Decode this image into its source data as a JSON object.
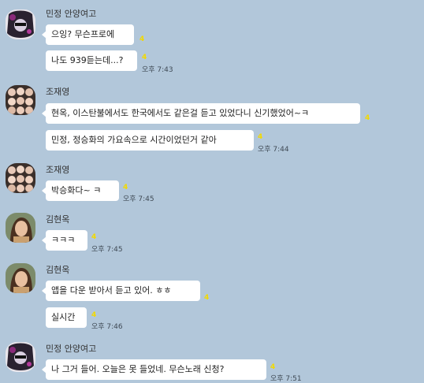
{
  "colors": {
    "background": "#b2c7da",
    "bubble": "#ffffff",
    "unread": "#f2d900"
  },
  "messages": [
    {
      "sender": "민정 안양여고",
      "avatar": "avatar-dark-icon",
      "bubbles": [
        {
          "text": "으잉? 무슨프로에",
          "unread": "4",
          "time": ""
        },
        {
          "text": "나도 939듣는데...?",
          "unread": "4",
          "time": "오후 7:43"
        }
      ]
    },
    {
      "sender": "조재영",
      "avatar": "avatar-group-icon",
      "bubbles": [
        {
          "text": "현옥, 이스탄불에서도 한국에서도 같은걸 듣고 있었다니 신기했었어~ㅋ",
          "unread": "4",
          "time": ""
        },
        {
          "text": "민정, 정승화의 가요속으로 시간이었던거 같아",
          "unread": "4",
          "time": "오후 7:44"
        }
      ]
    },
    {
      "sender": "조재영",
      "avatar": "avatar-group-icon",
      "bubbles": [
        {
          "text": "박승화다~ ㅋ",
          "unread": "4",
          "time": "오후 7:45"
        }
      ]
    },
    {
      "sender": "김현옥",
      "avatar": "avatar-woman-icon",
      "bubbles": [
        {
          "text": "ㅋㅋㅋ",
          "unread": "4",
          "time": "오후 7:45"
        }
      ]
    },
    {
      "sender": "김현옥",
      "avatar": "avatar-woman-icon",
      "bubbles": [
        {
          "text": "앱을 다운 받아서 듣고 있어. ㅎㅎ",
          "unread": "4",
          "time": ""
        },
        {
          "text": "실시간",
          "unread": "4",
          "time": "오후 7:46"
        }
      ]
    },
    {
      "sender": "민정 안양여고",
      "avatar": "avatar-dark-icon",
      "bubbles": [
        {
          "text": "나 그거 들어. 오늘은 못 들었네. 무슨노래 신청?",
          "unread": "4",
          "time": "오후 7:51"
        }
      ]
    }
  ]
}
